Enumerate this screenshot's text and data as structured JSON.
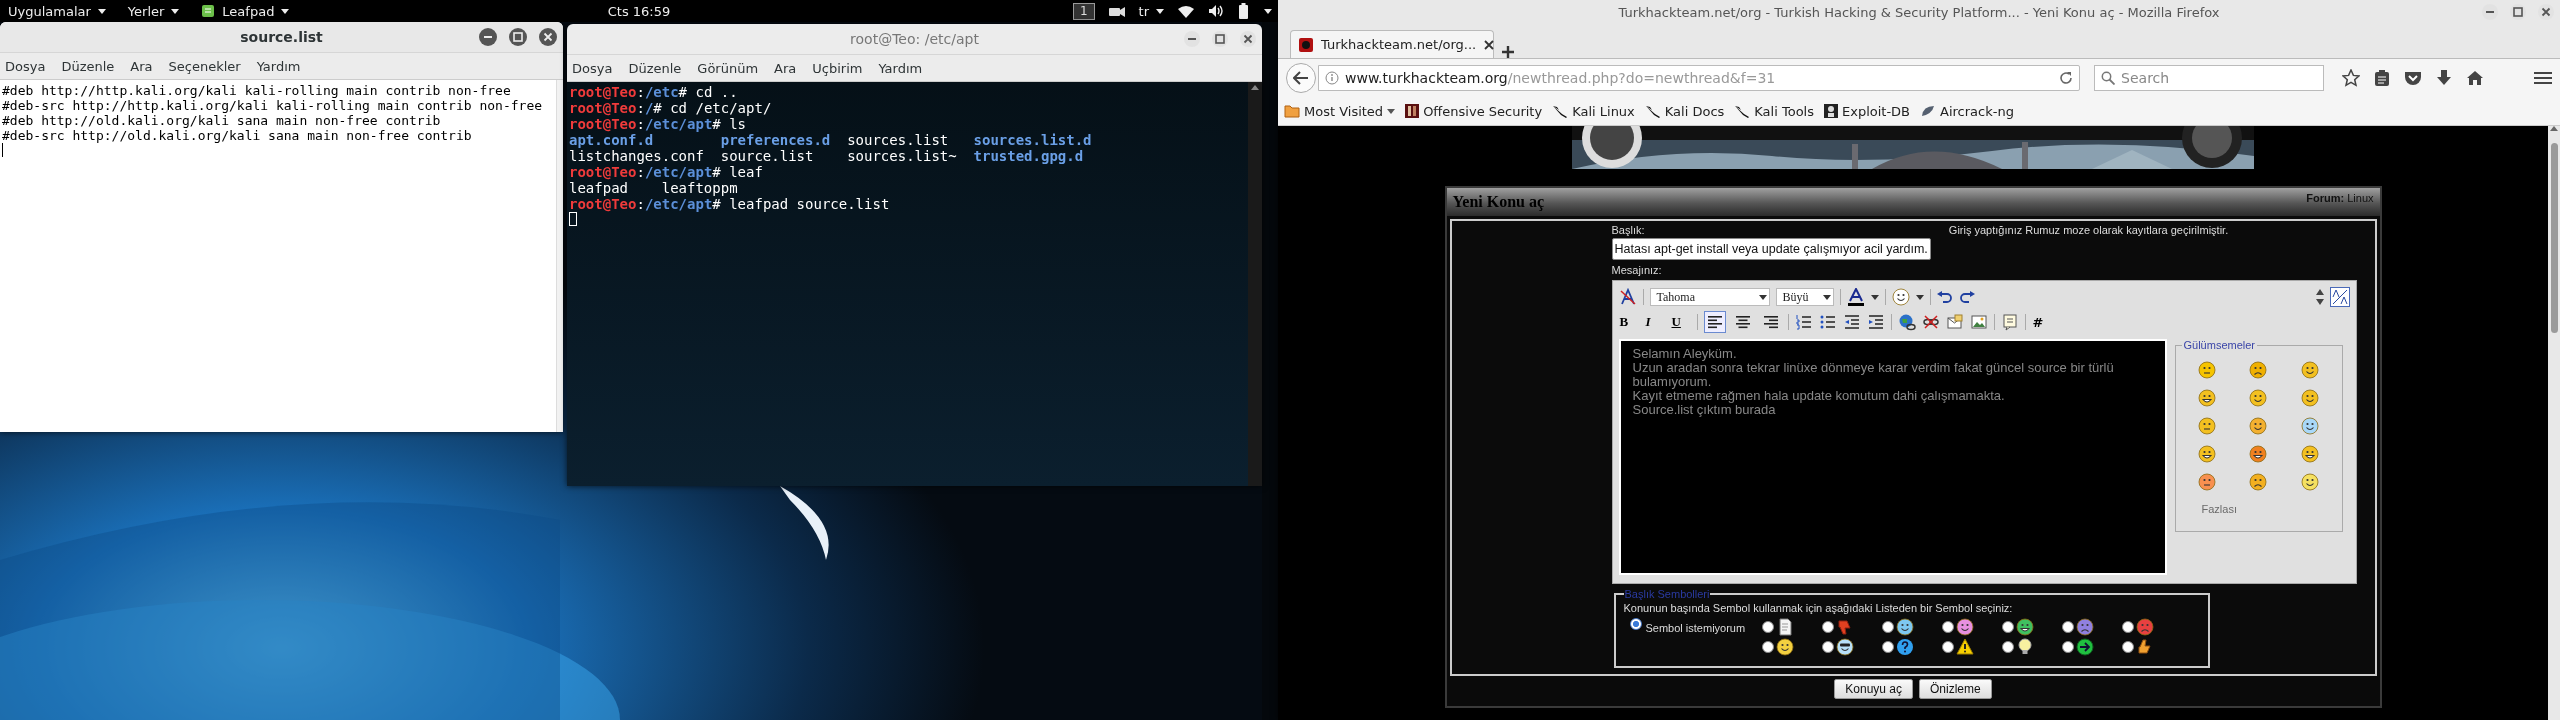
{
  "top_bar": {
    "menus": [
      {
        "label": "Uygulamalar",
        "kind": "plain"
      },
      {
        "label": "Yerler",
        "kind": "plain"
      },
      {
        "label": "Leafpad",
        "kind": "app"
      }
    ],
    "clock": "Cts 16:59",
    "workspace": "1",
    "keyboard": "tr"
  },
  "leafpad": {
    "title": "source.list",
    "menu": [
      "Dosya",
      "Düzenle",
      "Ara",
      "Seçenekler",
      "Yardım"
    ],
    "lines": [
      "#deb http://http.kali.org/kali kali-rolling main contrib non-free",
      "#deb-src http://http.kali.org/kali kali-rolling main contrib non-free",
      "#deb http://old.kali.org/kali sana main non-free contrib",
      "#deb-src http://old.kali.org/kali sana main non-free contrib"
    ]
  },
  "terminal": {
    "title": "root@Teo: /etc/apt",
    "menu": [
      "Dosya",
      "Düzenle",
      "Görünüm",
      "Ara",
      "Uçbirim",
      "Yardım"
    ],
    "lines": [
      {
        "kind": "prompt",
        "parts": [
          {
            "text": "root@Teo",
            "kind": "user"
          },
          {
            "text": ":",
            "kind": "plain"
          },
          {
            "text": "/etc",
            "kind": "path"
          },
          {
            "text": "# cd ..",
            "kind": "plain"
          }
        ]
      },
      {
        "kind": "prompt",
        "parts": [
          {
            "text": "root@Teo",
            "kind": "user"
          },
          {
            "text": ":",
            "kind": "plain"
          },
          {
            "text": "/",
            "kind": "path"
          },
          {
            "text": "# cd /etc/apt/",
            "kind": "plain"
          }
        ]
      },
      {
        "kind": "prompt",
        "parts": [
          {
            "text": "root@Teo",
            "kind": "user"
          },
          {
            "text": ":",
            "kind": "plain"
          },
          {
            "text": "/etc/apt",
            "kind": "path"
          },
          {
            "text": "# ls",
            "kind": "plain"
          }
        ]
      },
      {
        "kind": "listing",
        "items": [
          {
            "text": "apt.conf.d",
            "kind": "dir"
          },
          {
            "text": "preferences.d",
            "kind": "dir"
          },
          {
            "text": "sources.list",
            "kind": "file"
          },
          {
            "text": "sources.list.d",
            "kind": "dir"
          }
        ]
      },
      {
        "kind": "listing",
        "items": [
          {
            "text": "listchanges.conf",
            "kind": "file"
          },
          {
            "text": "source.list",
            "kind": "file"
          },
          {
            "text": "sources.list~",
            "kind": "file"
          },
          {
            "text": "trusted.gpg.d",
            "kind": "dir"
          }
        ]
      },
      {
        "kind": "prompt",
        "parts": [
          {
            "text": "root@Teo",
            "kind": "user"
          },
          {
            "text": ":",
            "kind": "plain"
          },
          {
            "text": "/etc/apt",
            "kind": "path"
          },
          {
            "text": "# leaf",
            "kind": "plain"
          }
        ]
      },
      {
        "kind": "listing",
        "items": [
          {
            "text": "leafpad",
            "kind": "file"
          },
          {
            "text": "leaftoppm",
            "kind": "file"
          }
        ]
      },
      {
        "kind": "prompt",
        "parts": [
          {
            "text": "root@Teo",
            "kind": "user"
          },
          {
            "text": ":",
            "kind": "plain"
          },
          {
            "text": "/etc/apt",
            "kind": "path"
          },
          {
            "text": "# leafpad source.list",
            "kind": "plain"
          }
        ]
      }
    ]
  },
  "firefox": {
    "title": "Turkhackteam.net/org - Turkish Hacking & Security Platform... - Yeni Konu aç - Mozilla Firefox",
    "tabs": [
      {
        "label": "Turkhackteam.net/org...",
        "selected": true
      }
    ],
    "url": {
      "host": "www.turkhackteam.org",
      "path": "/newthread.php?do=newthread&f=31"
    },
    "search": {
      "placeholder": "Search"
    },
    "bookmarks": [
      {
        "label": "Most Visited",
        "kind": "folder"
      },
      {
        "label": "Offensive Security",
        "kind": "offsec"
      },
      {
        "label": "Kali Linux",
        "kind": "kali"
      },
      {
        "label": "Kali Docs",
        "kind": "kali"
      },
      {
        "label": "Kali Tools",
        "kind": "kali"
      },
      {
        "label": "Exploit-DB",
        "kind": "exploit"
      },
      {
        "label": "Aircrack-ng",
        "kind": "aircrack"
      }
    ],
    "page": {
      "header": {
        "title": "Yeni Konu aç",
        "forum": "**Forum:** Linux"
      },
      "form": {
        "title_label": "Başlık:",
        "title_value": "Hatası apt-get install veya update çalışmıyor acil yardım.",
        "notice": "Giriş yaptığınız Rumuz moze olarak kayıtlara geçirilmiştir.",
        "message_label": "Mesajınız:",
        "font": "Tahoma",
        "size": "Büyü",
        "format_buttons": [
          "B",
          "I",
          "U"
        ],
        "align_buttons": [
          {
            "selected": true
          },
          {
            "selected": false
          },
          {
            "selected": false
          }
        ],
        "hash_button": "#",
        "message_lines": [
          "Selamın Aleyküm.",
          "Uzun aradan sonra tekrar linüxe dönmeye karar verdim fakat güncel source bir türlü bulamıyorum.",
          "Kayıt etmeme rağmen hala update komutum dahi çalışmamakta.",
          "Source.list çıktım burada"
        ],
        "smilies": {
          "legend": "Gülümsemeler",
          "more": "Fazlası"
        },
        "symbols": {
          "legend": "Başlık Sembolleri",
          "instruction": "Konunun başında Sembol kullanmak için aşağıdaki Listeden bir Sembol seçiniz:",
          "options": [
            {
              "label": "Sembol istemiyorum",
              "selected": true
            },
            {
              "selected": false
            },
            {
              "selected": false
            },
            {
              "selected": false
            },
            {
              "selected": false
            },
            {
              "selected": false
            },
            {
              "selected": false
            },
            {
              "selected": false
            },
            {
              "selected": false
            },
            {
              "selected": false
            },
            {
              "selected": false
            },
            {
              "selected": false
            },
            {
              "selected": false
            },
            {
              "selected": false
            },
            {
              "selected": false
            }
          ]
        },
        "buttons": [
          "Konuyu aç",
          "Önizleme"
        ]
      }
    }
  }
}
